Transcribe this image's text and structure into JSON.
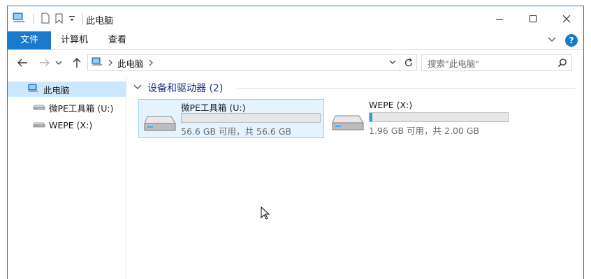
{
  "window": {
    "title": "此电脑",
    "controls": {
      "minimize": "minimize-icon",
      "maximize": "maximize-icon",
      "close": "close-icon"
    }
  },
  "ribbon": {
    "tabs": [
      {
        "label": "文件",
        "active": true
      },
      {
        "label": "计算机",
        "active": false
      },
      {
        "label": "查看",
        "active": false
      }
    ],
    "accent_color": "#1979ca",
    "help_label": "?"
  },
  "address": {
    "path": [
      "此电脑"
    ],
    "search_placeholder": "搜索\"此电脑\""
  },
  "nav_pane": {
    "root": "此电脑",
    "drives": [
      {
        "label": "微PE工具箱 (U:)"
      },
      {
        "label": "WEPE (X:)"
      }
    ]
  },
  "content": {
    "group_title": "设备和驱动器 (2)",
    "drives": [
      {
        "name": "微PE工具箱 (U:)",
        "info": "56.6 GB 可用，共 56.6 GB",
        "used_fraction": 0.0,
        "selected": true
      },
      {
        "name": "WEPE (X:)",
        "info": "1.96 GB 可用，共 2.00 GB",
        "used_fraction": 0.02,
        "selected": false
      }
    ]
  }
}
